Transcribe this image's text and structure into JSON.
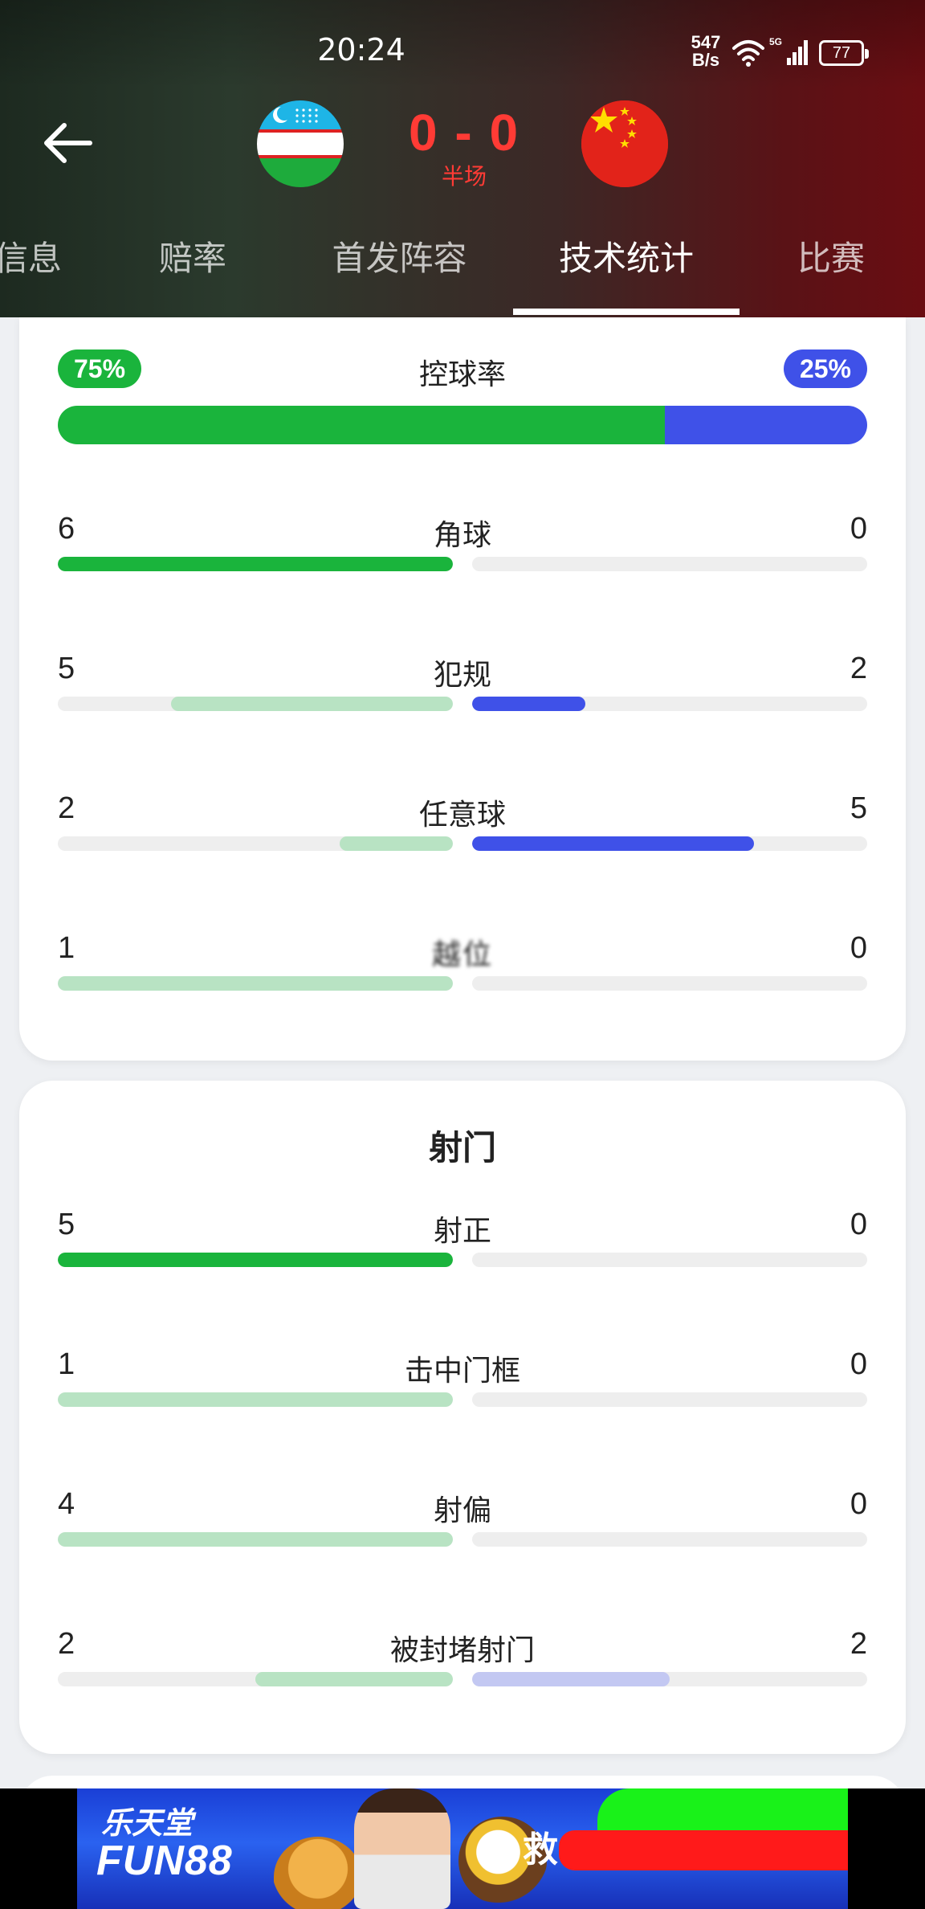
{
  "status_bar": {
    "time": "20:24",
    "net_speed_value": "547",
    "net_speed_unit": "B/s",
    "battery": "77"
  },
  "match": {
    "score": "0 - 0",
    "period": "半场",
    "home_flag": "uzbekistan-flag",
    "away_flag": "china-flag"
  },
  "tabs": [
    {
      "label": "信息"
    },
    {
      "label": "赔率"
    },
    {
      "label": "首发阵容"
    },
    {
      "label": "技术统计",
      "active": true
    },
    {
      "label": "比赛"
    }
  ],
  "colors": {
    "home": "#1ab43c",
    "home_light": "#b8e3c3",
    "away": "#3f51e8",
    "away_light": "#c3c8f2",
    "score": "#ff3b35"
  },
  "possession": {
    "label": "控球率",
    "home": "75%",
    "away": "25%",
    "home_value": 75,
    "away_value": 25
  },
  "general_stats": [
    {
      "label": "角球",
      "home": "6",
      "away": "0",
      "home_fill": 1.0,
      "away_fill": 0,
      "home_strong": true
    },
    {
      "label": "犯规",
      "home": "5",
      "away": "2",
      "home_fill": 0.714,
      "away_fill": 0.286,
      "away_strong": true
    },
    {
      "label": "任意球",
      "home": "2",
      "away": "5",
      "home_fill": 0.286,
      "away_fill": 0.714,
      "away_strong": true
    },
    {
      "label": "越位",
      "home": "1",
      "away": "0",
      "home_fill": 1.0,
      "away_fill": 0,
      "blurred": true
    }
  ],
  "shooting": {
    "title": "射门",
    "stats": [
      {
        "label": "射正",
        "home": "5",
        "away": "0",
        "home_fill": 1.0,
        "away_fill": 0,
        "home_strong": true
      },
      {
        "label": "击中门框",
        "home": "1",
        "away": "0",
        "home_fill": 1.0,
        "away_fill": 0
      },
      {
        "label": "射偏",
        "home": "4",
        "away": "0",
        "home_fill": 1.0,
        "away_fill": 0
      },
      {
        "label": "被封堵射门",
        "home": "2",
        "away": "2",
        "home_fill": 0.5,
        "away_fill": 0.5
      }
    ]
  },
  "ad": {
    "brand_cn": "乐天堂",
    "brand": "FUN88",
    "partial_text": "救"
  }
}
